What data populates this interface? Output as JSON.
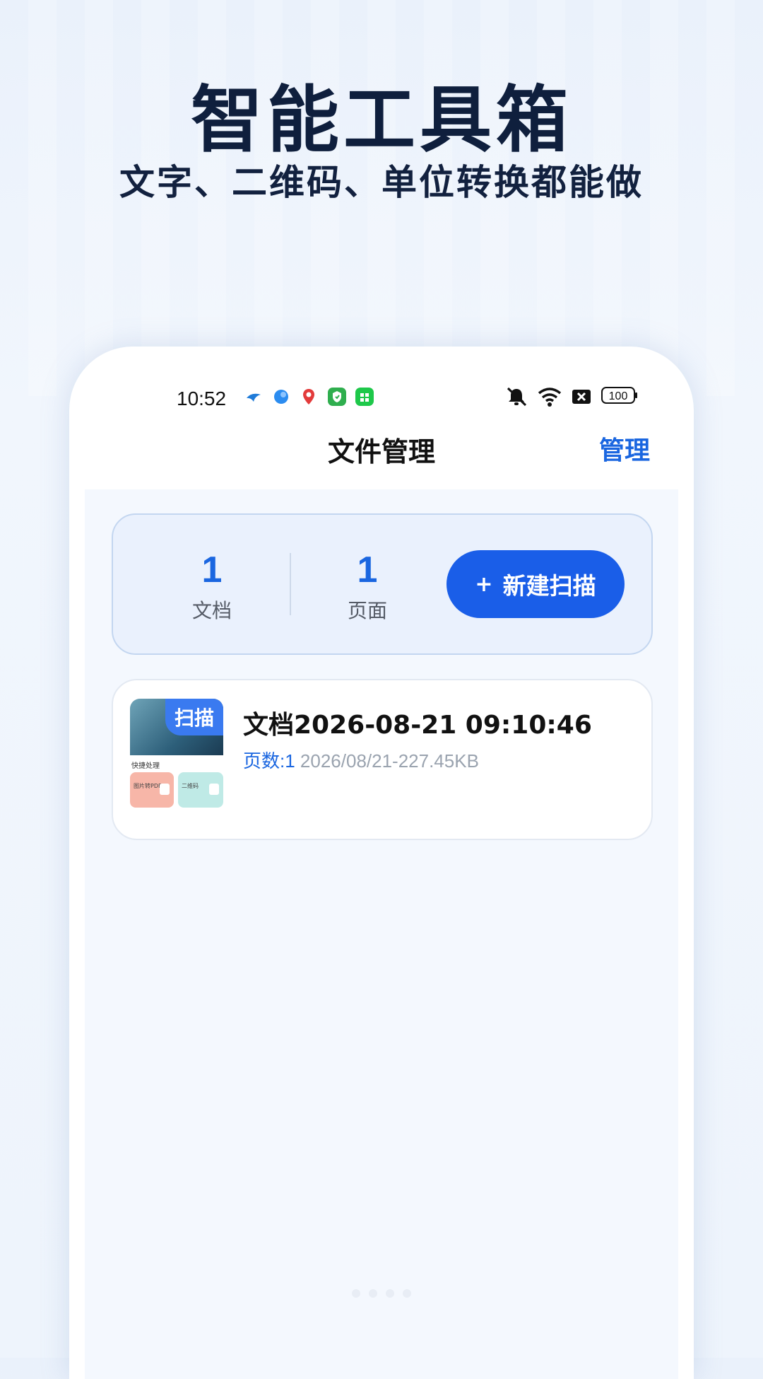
{
  "promo": {
    "title": "智能工具箱",
    "subtitle": "文字、二维码、单位转换都能做"
  },
  "status_bar": {
    "time": "10:52",
    "battery": "100",
    "notification_icons": [
      "app-icon-blue-bird",
      "app-icon-blue-circle",
      "map-pin-icon",
      "shield-app-icon",
      "green-app-icon"
    ],
    "system_icons": [
      "mute-bell-icon",
      "wifi-icon",
      "sim-off-icon",
      "battery-icon"
    ]
  },
  "nav": {
    "title": "文件管理",
    "manage_label": "管理"
  },
  "stats": {
    "documents_value": "1",
    "documents_label": "文档",
    "pages_value": "1",
    "pages_label": "页面",
    "new_scan_label": "新建扫描",
    "new_scan_icon": "+"
  },
  "documents": [
    {
      "name": "文档2026-08-21 09:10:46",
      "pages_label": "页数:1",
      "meta": "2026/08/21-227.45KB",
      "thumbnail": {
        "badge": "扫描",
        "caption": "快捷处理",
        "tile_a": "图片转PDF",
        "tile_b": "二维码"
      }
    }
  ],
  "colors": {
    "accent": "#1a66e0",
    "button": "#1a5ee8",
    "heading": "#0f1f3d"
  }
}
